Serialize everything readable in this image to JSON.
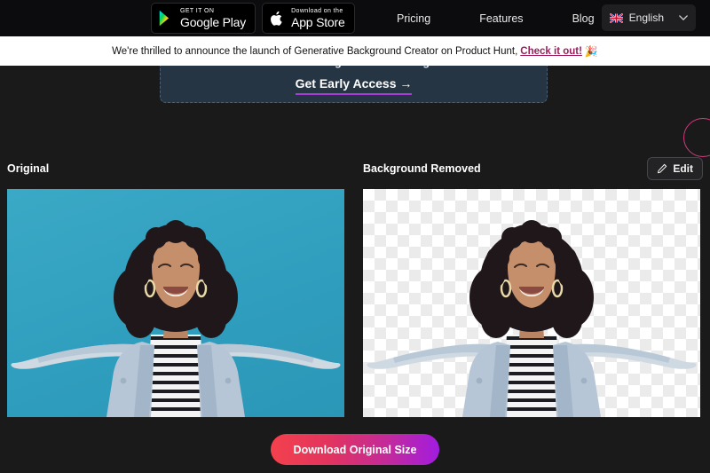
{
  "topnav": {
    "badges": [
      {
        "icon": "google-play-icon",
        "small": "GET IT ON",
        "big": "Google Play"
      },
      {
        "icon": "apple-icon",
        "small": "Download on the",
        "big": "App Store"
      }
    ],
    "links": [
      "Pricing",
      "Features",
      "Blog"
    ],
    "language": {
      "flag": "uk-flag-icon",
      "label": "English",
      "chevron": "chevron-down-icon"
    }
  },
  "announcement": {
    "text": "We're thrilled to announce the launch of Generative Background Creator on Product Hunt,",
    "link": "Check it out!",
    "emoji": "🎉"
  },
  "promo": {
    "title": "Want to Remove Background from Images in Bulk?",
    "cta": "Get Early Access →"
  },
  "compare": {
    "original_label": "Original",
    "removed_label": "Background Removed",
    "edit_button": "Edit",
    "edit_icon": "pencil-icon"
  },
  "download": {
    "label": "Download Original Size",
    "gradient_from": "#f4414d",
    "gradient_to": "#a21ce0"
  },
  "colors": {
    "page_bg": "#1a1a1a",
    "nav_bg": "#0c0c0e",
    "banner_bg": "#ffffff",
    "promo_bg": "#253544",
    "accent_pink": "#d13a7e",
    "accent_purple": "#a83bd6",
    "photo_bg": "#35a5c4"
  }
}
